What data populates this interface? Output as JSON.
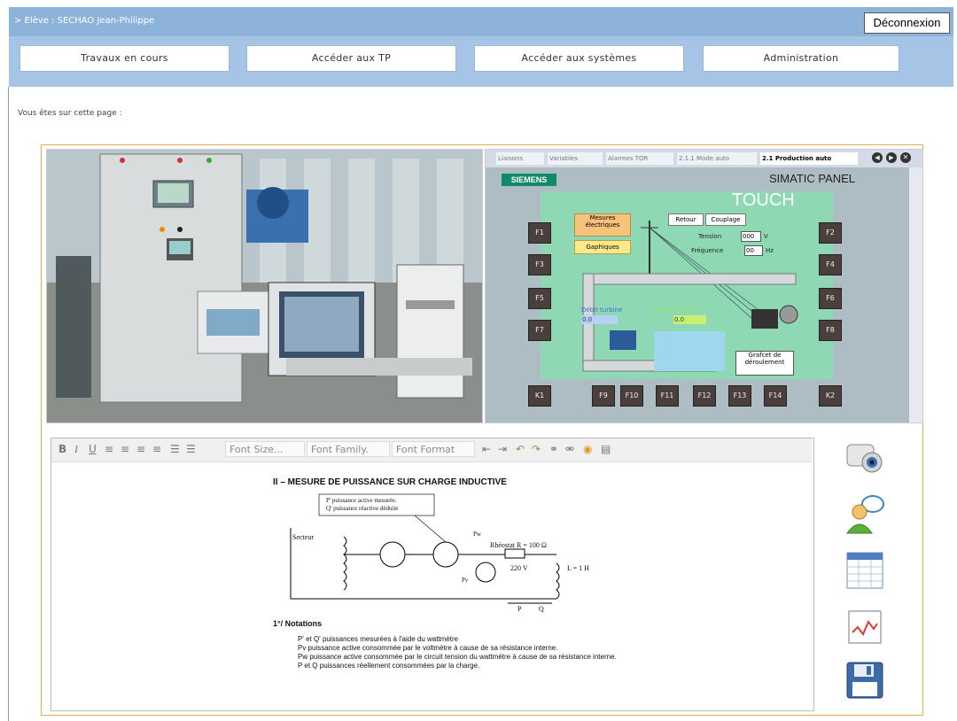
{
  "header": {
    "breadcrumb": "> Elève : SECHAO  Jean-Philippe",
    "logout_label": "Déconnexion"
  },
  "nav": [
    "Travaux en cours",
    "Accéder aux TP",
    "Accéder aux systèmes",
    "Administration"
  ],
  "page_location_label": "Vous êtes sur cette page :",
  "panel": {
    "tabs": [
      "Liaisons",
      "Variables",
      "Alarmes TOR",
      "2.1.1 Mode auto",
      "2.1 Production auto"
    ],
    "brand": "SIEMENS",
    "title": "SIMATIC PANEL",
    "subtitle": "TOUCH",
    "buttons_left": [
      "F1",
      "F3",
      "F5",
      "F7",
      "K1"
    ],
    "buttons_right": [
      "F2",
      "F4",
      "F6",
      "F8",
      "K2"
    ],
    "buttons_bottom": [
      "F9",
      "F10",
      "F11",
      "F12",
      "F13",
      "F14"
    ],
    "mesures": "Mesures électriques",
    "graphiques": "Gaphiques",
    "retour": "Retour",
    "couplage": "Couplage",
    "tension_label": "Tension",
    "tension_value": "000",
    "tension_unit": "V",
    "frequence_label": "Fréquence",
    "frequence_value": "00",
    "frequence_unit": "Hz",
    "debit_label": "Débit turbine",
    "debit_value": "0.0",
    "pression_label": "Pression (bars)",
    "pression_value": "0.0",
    "grafcet": "Grafcet de déroulement"
  },
  "editor": {
    "font_size": "Font Size...",
    "font_family": "Font Family.",
    "font_format": "Font Format",
    "doc_title": "II – MESURE DE PUISSANCE SUR CHARGE INDUCTIVE",
    "legend1": "P' puissance active mesurée.",
    "legend2": "Q' puissance réactive déduite",
    "secteur": "Secteur",
    "rheostat": "Rhéostat R = 100 Ω",
    "voltage": "220 V",
    "inductance": "L = 1 H",
    "pw": "Pw",
    "pv": "Pv",
    "p_label": "P",
    "q_label": "Q",
    "notations_title": "1°/ Notations",
    "notes": [
      "P' et Q' puissances mesurées à l'aide du wattmètre",
      "Pv puissance active consommée par le voltmètre à cause de sa résistance interne.",
      "Pw puissance active consommée par le circuit tension du wattmètre à cause de sa résistance interne.",
      "P et Q puissances réellement consommées par la charge."
    ]
  }
}
